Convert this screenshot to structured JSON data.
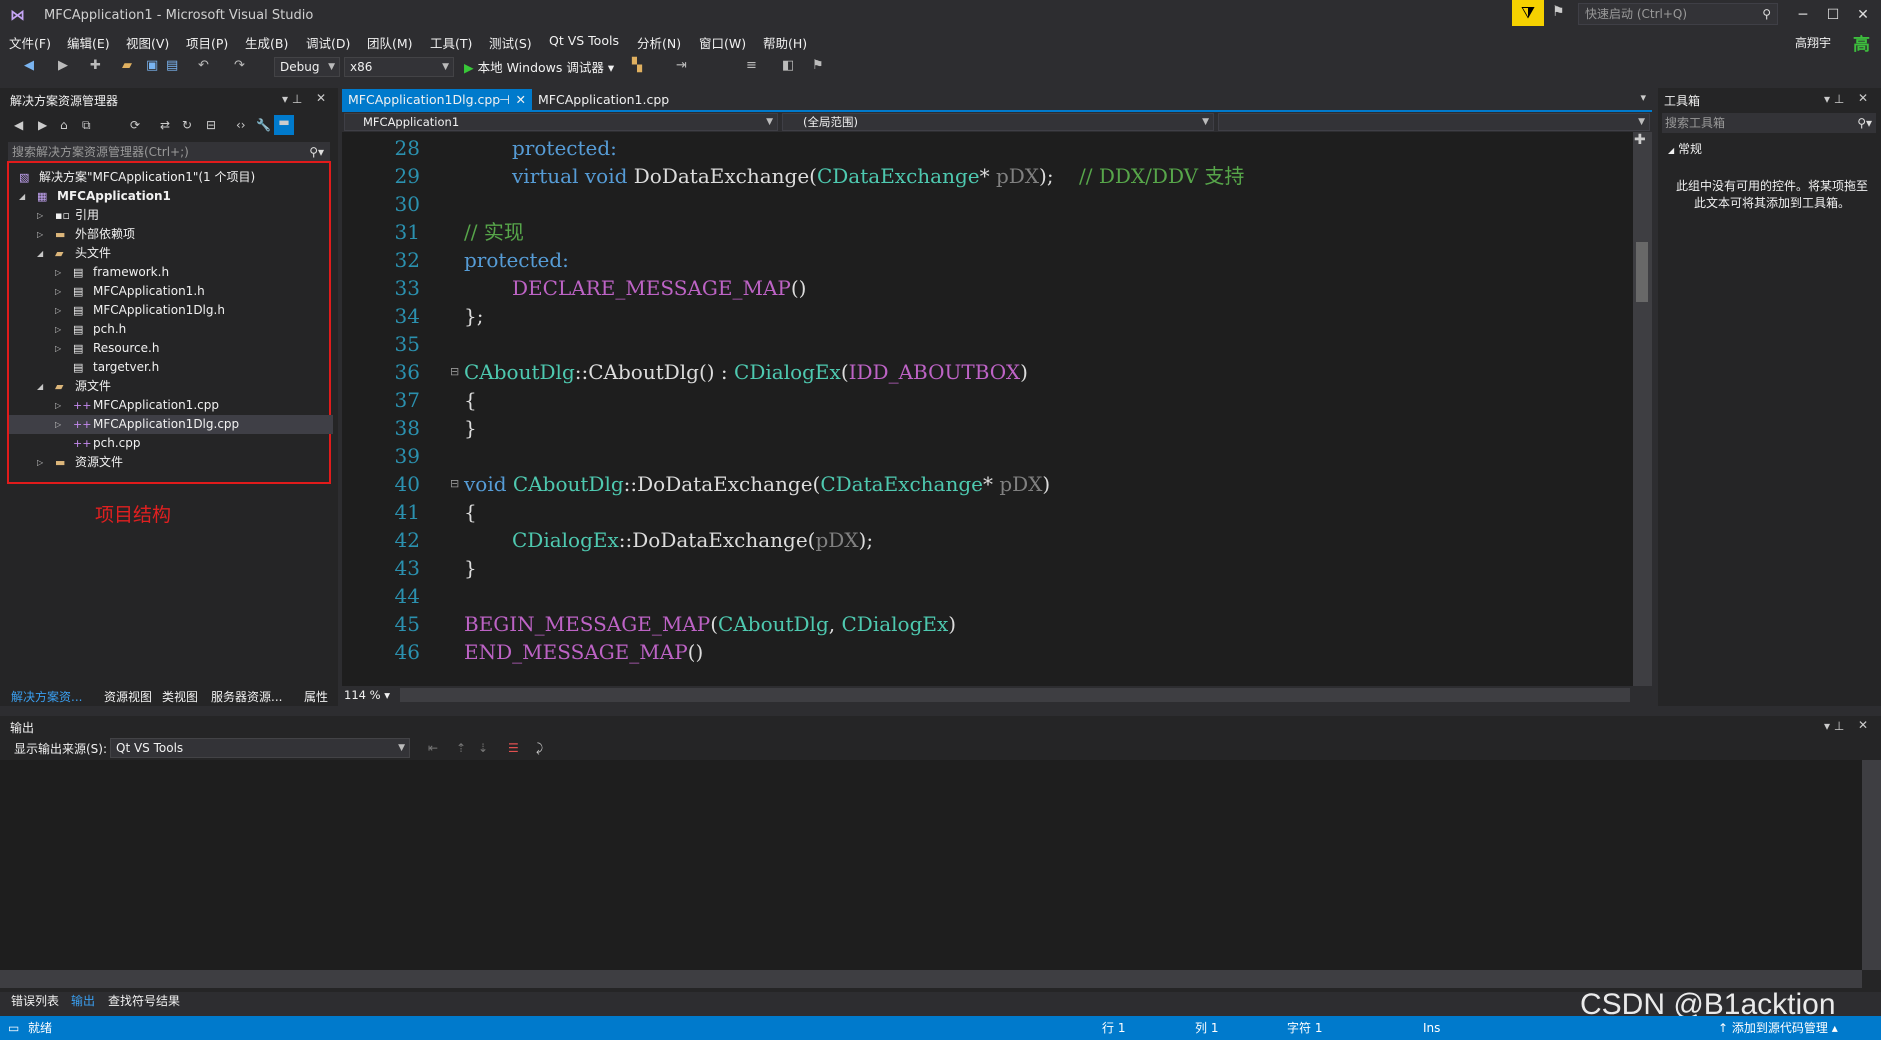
{
  "window": {
    "title": "MFCApplication1 - Microsoft Visual Studio",
    "quick_launch_placeholder": "快速启动 (Ctrl+Q)",
    "user_name": "高翔宇",
    "user_badge": "高"
  },
  "menu": [
    "文件(F)",
    "编辑(E)",
    "视图(V)",
    "项目(P)",
    "生成(B)",
    "调试(D)",
    "团队(M)",
    "工具(T)",
    "测试(S)",
    "Qt VS Tools",
    "分析(N)",
    "窗口(W)",
    "帮助(H)"
  ],
  "toolbar": {
    "config": "Debug",
    "platform": "x86",
    "run_label": "本地 Windows 调试器"
  },
  "solution_explorer": {
    "title": "解决方案资源管理器",
    "search_placeholder": "搜索解决方案资源管理器(Ctrl+;)",
    "tree": [
      {
        "label": "解决方案\"MFCApplication1\"(1 个项目)",
        "icon": "solution-icon"
      },
      {
        "label": "MFCApplication1",
        "icon": "project-icon"
      },
      {
        "label": "引用",
        "icon": "references-icon"
      },
      {
        "label": "外部依赖项",
        "icon": "folder-icon"
      },
      {
        "label": "头文件",
        "icon": "folder-open-icon"
      },
      {
        "label": "framework.h",
        "icon": "header-file-icon"
      },
      {
        "label": "MFCApplication1.h",
        "icon": "header-file-icon"
      },
      {
        "label": "MFCApplication1Dlg.h",
        "icon": "header-file-icon"
      },
      {
        "label": "pch.h",
        "icon": "header-file-icon"
      },
      {
        "label": "Resource.h",
        "icon": "header-file-icon"
      },
      {
        "label": "targetver.h",
        "icon": "header-file-icon"
      },
      {
        "label": "源文件",
        "icon": "folder-open-icon"
      },
      {
        "label": "MFCApplication1.cpp",
        "icon": "cpp-file-icon"
      },
      {
        "label": "MFCApplication1Dlg.cpp",
        "icon": "cpp-file-icon"
      },
      {
        "label": "pch.cpp",
        "icon": "cpp-file-icon"
      },
      {
        "label": "资源文件",
        "icon": "folder-icon"
      }
    ],
    "annotation": "项目结构",
    "bottom_tabs": [
      "解决方案资...",
      "资源视图",
      "类视图",
      "服务器资源...",
      "属性"
    ]
  },
  "editor": {
    "tabs": [
      "MFCApplication1Dlg.cpp",
      "MFCApplication1.cpp"
    ],
    "nav_project": "MFCApplication1",
    "nav_scope": "(全局范围)",
    "zoom": "114 %",
    "line_numbers": [
      "28",
      "29",
      "30",
      "31",
      "32",
      "33",
      "34",
      "35",
      "36",
      "37",
      "38",
      "39",
      "40",
      "41",
      "42",
      "43",
      "44",
      "45",
      "46"
    ],
    "code": {
      "l28": "protected:",
      "l29_virtual": "virtual",
      "l29_void": "void",
      "l29_fn": "DoDataExchange(",
      "l29_type": "CDataExchange",
      "l29_rest": "* ",
      "l29_param": "pDX",
      "l29_end": ");",
      "l29_comment": "// DDX/DDV 支持",
      "l31": "// 实现",
      "l32": "protected:",
      "l33": "DECLARE_MESSAGE_MAP",
      "l33_end": "()",
      "l34": "};",
      "l36_a": "CAboutDlg",
      "l36_b": "::CAboutDlg() : ",
      "l36_c": "CDialogEx",
      "l36_d": "(",
      "l36_e": "IDD_ABOUTBOX",
      "l36_f": ")",
      "l37": "{",
      "l38": "}",
      "l40_void": "void",
      "l40_cls": "CAboutDlg",
      "l40_fn": "::DoDataExchange(",
      "l40_type": "CDataExchange",
      "l40_star": "* ",
      "l40_param": "pDX",
      "l40_end": ")",
      "l41": "{",
      "l42_cls": "CDialogEx",
      "l42_fn": "::DoDataExchange(",
      "l42_param": "pDX",
      "l42_end": ");",
      "l43": "}",
      "l45_macro": "BEGIN_MESSAGE_MAP",
      "l45_open": "(",
      "l45_a": "CAboutDlg",
      "l45_sep": ", ",
      "l45_b": "CDialogEx",
      "l45_close": ")",
      "l46_macro": "END_MESSAGE_MAP",
      "l46_end": "()"
    }
  },
  "toolbox": {
    "title": "工具箱",
    "search_placeholder": "搜索工具箱",
    "group": "常规",
    "message": "此组中没有可用的控件。将某项拖至此文本可将其添加到工具箱。"
  },
  "output": {
    "title": "输出",
    "source_label": "显示输出来源(S):",
    "source_value": "Qt VS Tools",
    "bottom_tabs": [
      "错误列表",
      "输出",
      "查找符号结果"
    ]
  },
  "status": {
    "ready": "就绪",
    "row": "行 1",
    "col": "列 1",
    "char": "字符 1",
    "ins": "Ins",
    "source_control": "添加到源代码管理"
  },
  "watermark": "CSDN @B1acktion",
  "colors": {
    "accent": "#007acc",
    "annotation": "#e11b1b",
    "keyword": "#569cd6",
    "type": "#4ec9b0",
    "macro": "#bd63c5",
    "comment": "#57a64a"
  }
}
